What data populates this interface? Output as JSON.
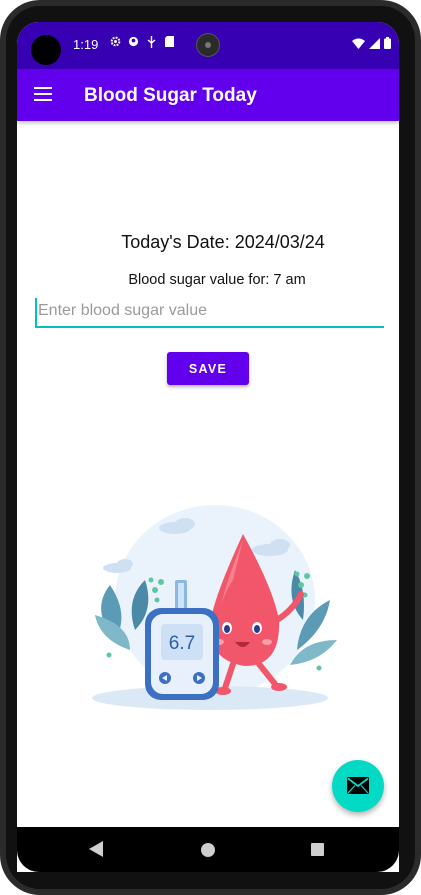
{
  "status_bar": {
    "time": "1:19",
    "icons_left": [
      "settings-icon",
      "sync-icon",
      "usb-icon",
      "sd-card-icon"
    ],
    "icons_right": [
      "wifi-icon",
      "signal-icon",
      "battery-icon"
    ]
  },
  "app_bar": {
    "title": "Blood Sugar Today",
    "menu_icon": "menu-icon"
  },
  "main": {
    "date_text": "Today's Date: 2024/03/24",
    "sugar_for_text": "Blood sugar value for: 7 am",
    "input_placeholder": "Enter blood sugar value",
    "input_value": "",
    "save_label": "SAVE",
    "meter_reading": "6.7"
  },
  "fab": {
    "icon": "email-icon"
  },
  "colors": {
    "primary": "#6200ee",
    "primary_dark": "#3700b3",
    "accent": "#03dac5"
  }
}
